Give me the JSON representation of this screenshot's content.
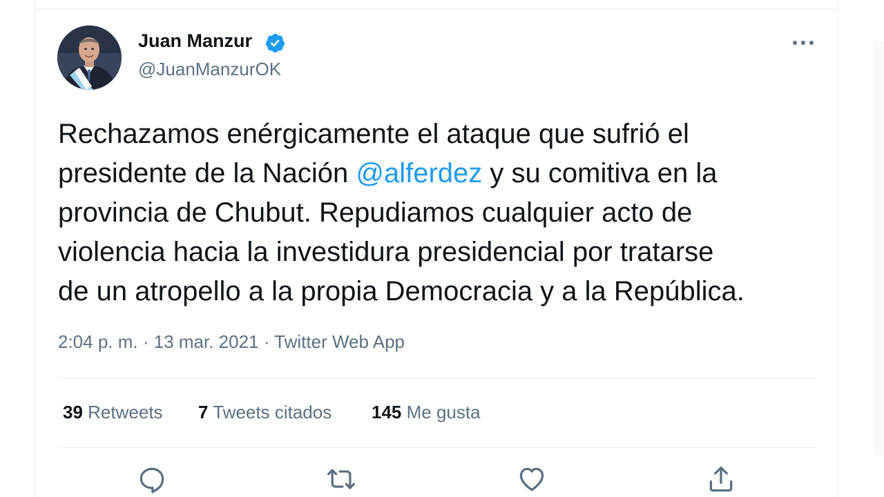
{
  "tweet": {
    "author": {
      "name": "Juan Manzur",
      "handle": "@JuanManzurOK",
      "verified": true,
      "avatar_icon": "profile-photo"
    },
    "text": {
      "line1": "Rechazamos enérgicamente el ataque que sufrió el",
      "line2_pre": "presidente de la Nación ",
      "mention": "@alferdez",
      "line2_post": " y su comitiva en la",
      "line3": "provincia de Chubut. Repudiamos cualquier acto de",
      "line4": "violencia hacia la investidura presidencial por tratarse",
      "line5": "de un atropello a la propia Democracia y a la República."
    },
    "meta": {
      "time": "2:04 p. m.",
      "sep": " · ",
      "date": "13 mar. 2021",
      "source": "Twitter Web App"
    },
    "stats": {
      "retweets_count": "39",
      "retweets_label": "Retweets",
      "quotes_count": "7",
      "quotes_label": "Tweets citados",
      "likes_count": "145",
      "likes_label": "Me gusta"
    },
    "actions": [
      "reply-icon",
      "retweet-icon",
      "like-icon",
      "share-icon"
    ]
  },
  "colors": {
    "text_primary": "#0f1419",
    "text_secondary": "#5b7083",
    "accent": "#1d9bf0",
    "divider": "#ebeef0"
  }
}
